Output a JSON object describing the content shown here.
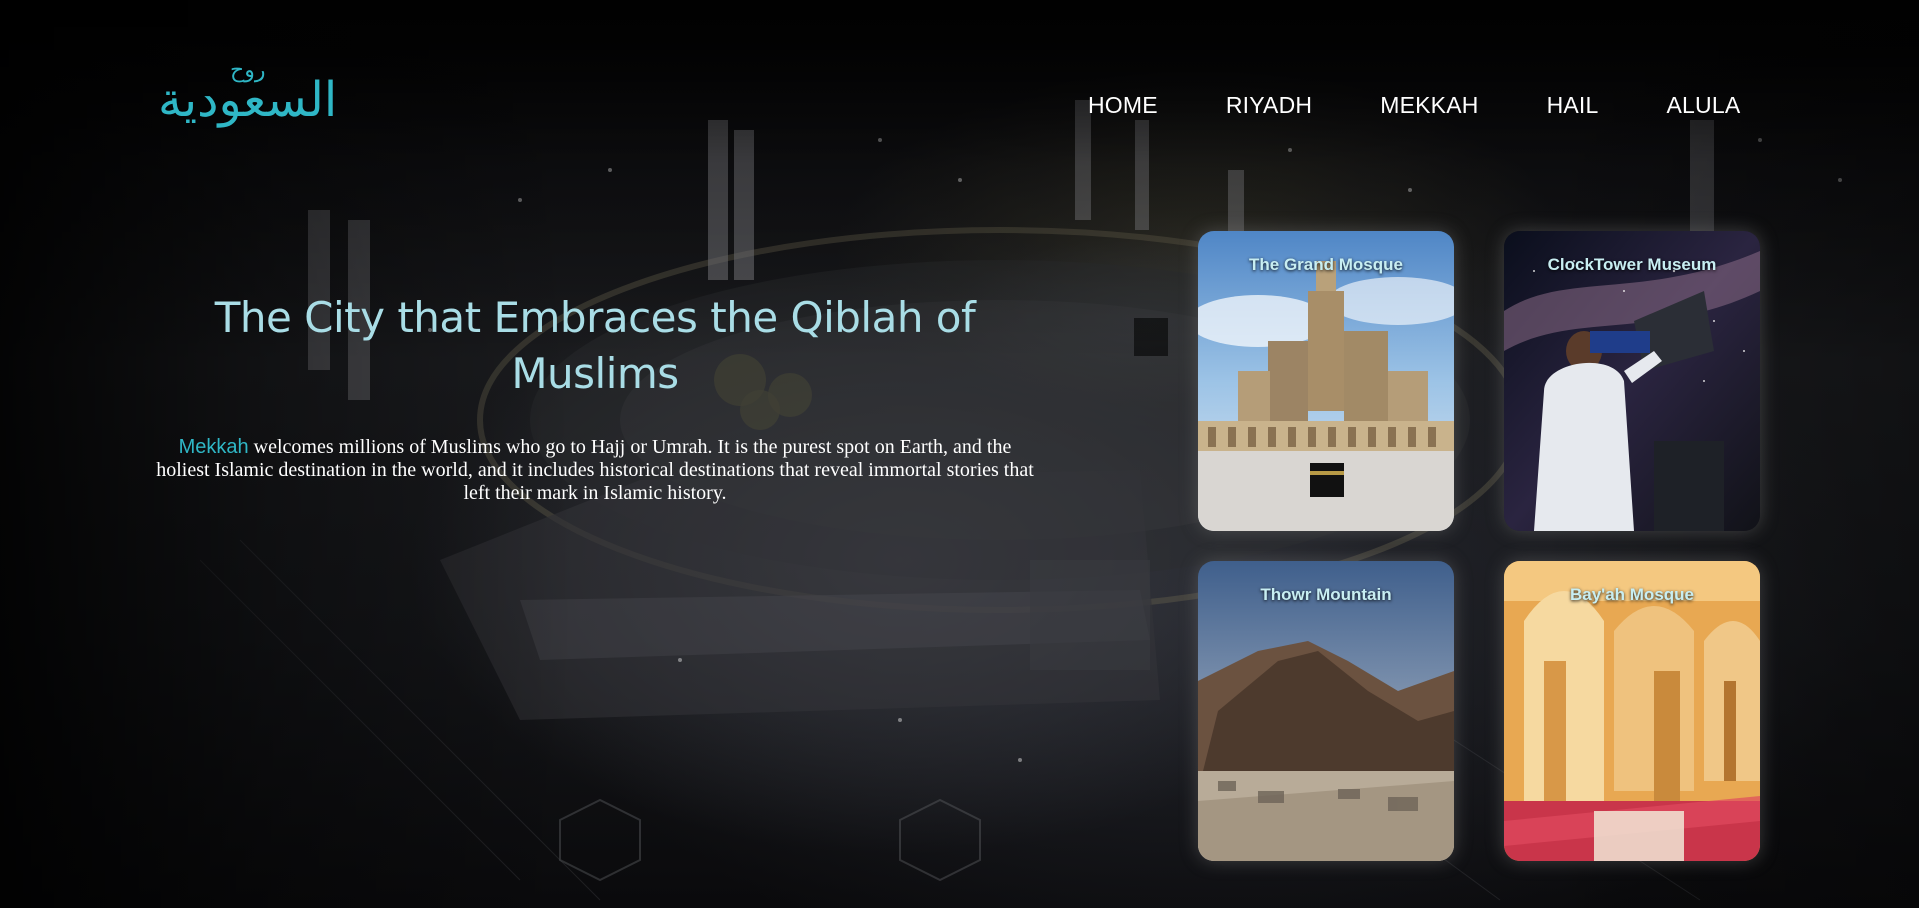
{
  "logo": {
    "small_text": "روح",
    "main_text": "السعودية",
    "color": "#2fb7c6"
  },
  "nav": {
    "items": [
      {
        "label": "HOME"
      },
      {
        "label": "RIYADH"
      },
      {
        "label": "MEKKAH"
      },
      {
        "label": "HAIL"
      },
      {
        "label": "ALULA"
      }
    ]
  },
  "hero": {
    "title": "The City that Embraces the Qiblah of Muslims",
    "accent_word": "Mekkah",
    "description": " welcomes millions of Muslims who go to Hajj or Umrah. It is the purest spot on Earth, and the holiest Islamic destination in the world, and it includes historical destinations that reveal immortal stories that left their mark in Islamic history."
  },
  "cards": [
    {
      "title": "The Grand Mosque"
    },
    {
      "title": "ClockTower Museum"
    },
    {
      "title": "Thowr Mountain"
    },
    {
      "title": "Bay'ah Mosque"
    }
  ],
  "colors": {
    "accent": "#2fb7c6",
    "title": "#a9dde6",
    "background": "#060606"
  }
}
